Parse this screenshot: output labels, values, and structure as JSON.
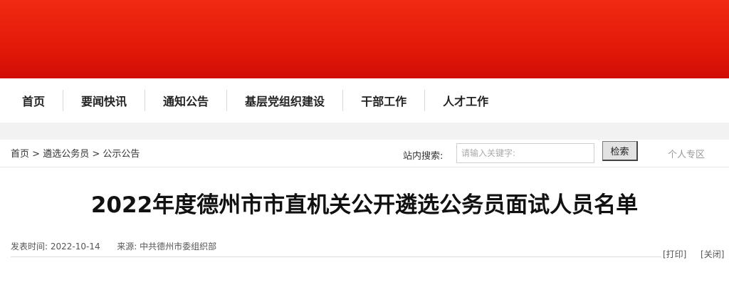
{
  "colors": {
    "banner": "#e51b0a",
    "page_bg": "#ffffff",
    "band": "#f2f2f2"
  },
  "nav": {
    "items": [
      {
        "label": "首页"
      },
      {
        "label": "要闻快讯"
      },
      {
        "label": "通知公告"
      },
      {
        "label": "基层党组织建设"
      },
      {
        "label": "干部工作"
      },
      {
        "label": "人才工作"
      }
    ]
  },
  "breadcrumb": {
    "items": [
      "首页",
      "遴选公务员",
      "公示公告"
    ],
    "separator": ">"
  },
  "search": {
    "label": "站内搜索:",
    "placeholder": "请输入关键字:",
    "button": "检索"
  },
  "personal_link": "个人专区",
  "article": {
    "title": "2022年度德州市市直机关公开遴选公务员面试人员名单",
    "published_label": "发表时间:",
    "published_date": "2022-10-14",
    "source_label": "来源:",
    "source": "中共德州市委组织部",
    "print": "[打印]",
    "close": "[关闭]"
  }
}
